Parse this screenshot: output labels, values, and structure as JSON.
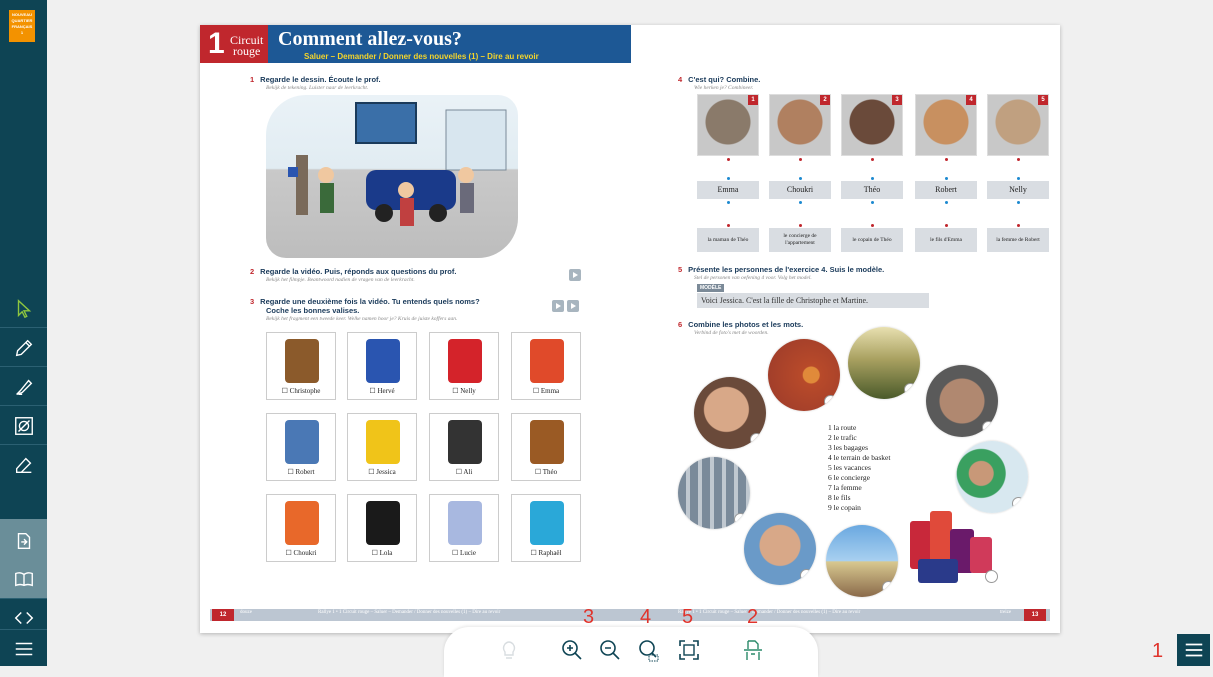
{
  "sidebar": {
    "logo_text": "NOUVEAU QUARTIER FRANÇAIS 1",
    "tools": [
      "cursor-icon",
      "pencil-icon",
      "highlighter-icon",
      "hide-icon",
      "eraser-icon"
    ],
    "nav": [
      "export-icon",
      "book-icon",
      "prev-next-icon",
      "menu-icon"
    ]
  },
  "header": {
    "unit_number": "1",
    "circuit": "Circuit",
    "circuit_color": "rouge",
    "title": "Comment allez-vous?",
    "subtitle": "Saluer – Demander / Donner des nouvelles (1) – Dire au revoir"
  },
  "left_page": {
    "ex1": {
      "num": "1",
      "title": "Regarde le dessin. Écoute le prof.",
      "sub": "Bekijk de tekening. Luister naar de leerkracht."
    },
    "ex2": {
      "num": "2",
      "title": "Regarde la vidéo. Puis, réponds aux questions du prof.",
      "sub": "Bekijk het filmpje. Beantwoord nadien de vragen van de leerkracht."
    },
    "ex3": {
      "num": "3",
      "title": "Regarde une deuxième fois la vidéo. Tu entends quels noms?",
      "title2": "Coche les bonnes valises.",
      "sub": "Bekijk het fragment een tweede keer. Welke namen hoor je? Kruis de juiste koffers aan."
    },
    "suitcases": [
      {
        "label": "☐ Christophe",
        "color": "#8b5a2b"
      },
      {
        "label": "☐ Hervé",
        "color": "#2a55b0"
      },
      {
        "label": "☐ Nelly",
        "color": "#d4232a"
      },
      {
        "label": "☐ Emma",
        "color": "#e04a2a"
      },
      {
        "label": "☐ Robert",
        "color": "#4a78b5"
      },
      {
        "label": "☐ Jessica",
        "color": "#f0c419"
      },
      {
        "label": "☐ Ali",
        "color": "#333333"
      },
      {
        "label": "☐ Théo",
        "color": "#9a5a24"
      },
      {
        "label": "☐ Choukri",
        "color": "#e8682a"
      },
      {
        "label": "☐ Lola",
        "color": "#1a1a1a"
      },
      {
        "label": "☐ Lucie",
        "color": "#a8b8e0"
      },
      {
        "label": "☐ Raphaël",
        "color": "#2aa8d8"
      }
    ],
    "footer_page": "12",
    "footer_word": "douze",
    "footer_text": "Rallye 1 • 1 Circuit rouge – Saluer – Demander / Donner des nouvelles (1) – Dire au revoir"
  },
  "right_page": {
    "ex4": {
      "num": "4",
      "title": "C'est qui? Combine.",
      "sub": "Wie herken je? Combineer."
    },
    "faces": [
      {
        "badge": "1",
        "color": "#8a7a6a"
      },
      {
        "badge": "2",
        "color": "#b08060"
      },
      {
        "badge": "3",
        "color": "#6a4a3a"
      },
      {
        "badge": "4",
        "color": "#c89060"
      },
      {
        "badge": "5",
        "color": "#c0a080"
      }
    ],
    "names": [
      "Emma",
      "Choukri",
      "Théo",
      "Robert",
      "Nelly"
    ],
    "descriptions": [
      "la maman de Théo",
      "le concierge de l'appartement",
      "le copain de Théo",
      "le fils d'Emma",
      "la femme de Robert"
    ],
    "ex5": {
      "num": "5",
      "title": "Présente les personnes de l'exercice 4. Suis le modèle.",
      "sub": "Stel de personen van oefening 4 voor. Volg het model."
    },
    "modele_label": "MODÈLE",
    "modele_sentence": "Voici Jessica. C'est la fille de Christophe et Martine.",
    "ex6": {
      "num": "6",
      "title": "Combine les photos et les mots.",
      "sub": "Verbind de foto's met de woorden."
    },
    "words": [
      "1  la route",
      "2  le trafic",
      "3  les bagages",
      "4  le terrain de basket",
      "5  les vacances",
      "6  le concierge",
      "7  la femme",
      "8  le fils",
      "9  le copain"
    ],
    "footer_page": "13",
    "footer_word": "treize",
    "footer_text": "Rallye 1 • 1 Circuit rouge – Saluer – Demander / Donner des nouvelles (1) – Dire au revoir"
  },
  "toolbar": {
    "icons": [
      "lightbulb-icon",
      "zoom-in-icon",
      "zoom-out-icon",
      "zoom-area-icon",
      "fit-screen-icon",
      "single-page-icon"
    ]
  },
  "annotations": [
    "3",
    "4",
    "5",
    "2",
    "1"
  ],
  "colors": {
    "accent_red": "#c0272d",
    "header_blue": "#1d5895",
    "sidebar": "#0e4454"
  }
}
